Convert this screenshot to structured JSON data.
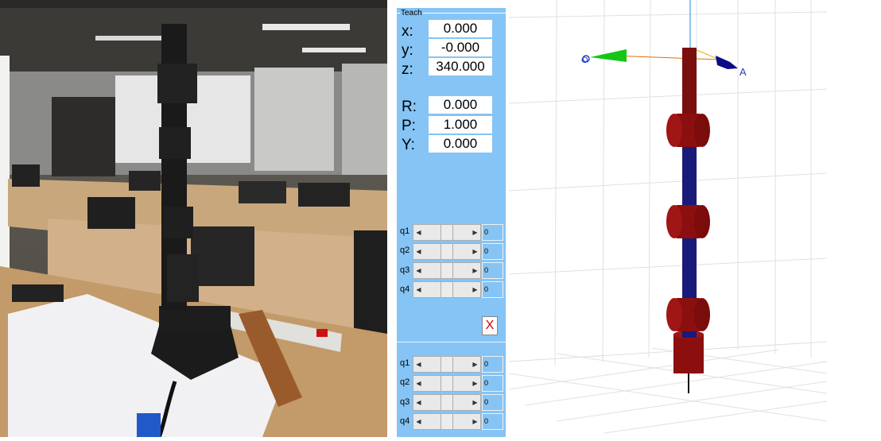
{
  "teach": {
    "title": "Teach",
    "pose": [
      {
        "label": "x:",
        "value": "0.000"
      },
      {
        "label": "y:",
        "value": "-0.000"
      },
      {
        "label": "z:",
        "value": "340.000"
      }
    ],
    "orient": [
      {
        "label": "R:",
        "value": "0.000"
      },
      {
        "label": "P:",
        "value": "1.000"
      },
      {
        "label": "Y:",
        "value": "0.000"
      }
    ],
    "joints_top": [
      {
        "label": "q1",
        "value": "0"
      },
      {
        "label": "q2",
        "value": "0"
      },
      {
        "label": "q3",
        "value": "0"
      },
      {
        "label": "q4",
        "value": "0"
      }
    ],
    "close_label": "X",
    "joints_bottom": [
      {
        "label": "q1",
        "value": "0"
      },
      {
        "label": "q2",
        "value": "0"
      },
      {
        "label": "q3",
        "value": "0"
      },
      {
        "label": "q4",
        "value": "0"
      }
    ]
  },
  "view3d": {
    "label_o": "O",
    "label_a": "A",
    "colors": {
      "link": "#1a1a7a",
      "joint": "#8b0f0f",
      "approach": "#0a0a8a",
      "orientation": "#15c615"
    }
  }
}
